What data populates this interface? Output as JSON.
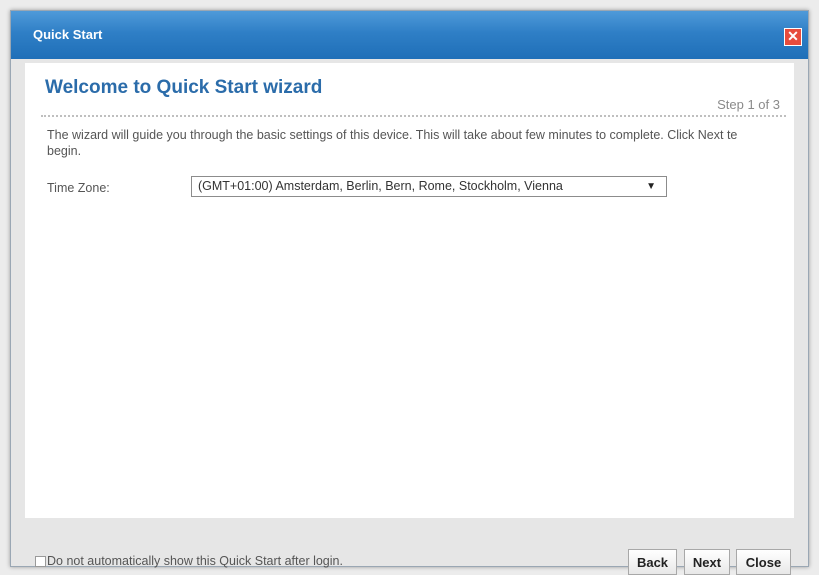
{
  "dialog": {
    "title": "Quick Start",
    "close_icon": "close-x-icon"
  },
  "wizard": {
    "heading": "Welcome to Quick Start wizard",
    "step": "Step 1 of 3",
    "description": "The wizard will guide you through the basic settings of this device. This will take about few minutes to complete. Click Next te begin."
  },
  "timezone": {
    "label": "Time Zone:",
    "selected": "(GMT+01:00) Amsterdam, Berlin, Bern, Rome, Stockholm, Vienna",
    "arrow": "▼"
  },
  "footer": {
    "checkbox_label": "Do not automatically show this Quick Start after login.",
    "checkbox_checked": false,
    "back": "Back",
    "next": "Next",
    "close": "Close"
  },
  "colors": {
    "titlebar": "#2f7fc6",
    "heading": "#2b6caa",
    "close_button": "#e74c3c"
  }
}
